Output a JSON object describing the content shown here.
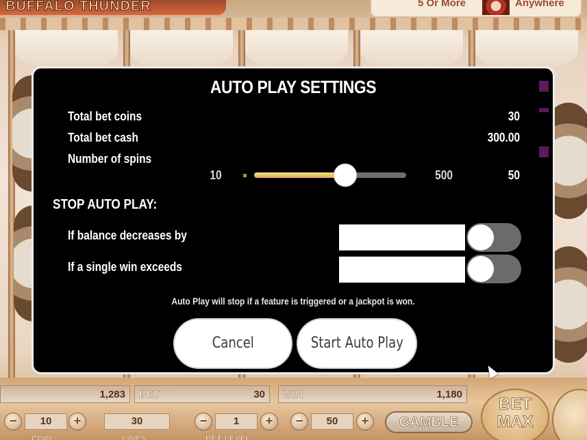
{
  "header": {
    "logo_text": "BUFFALO THUNDER",
    "info_left": "5 Or More",
    "info_right": "Anywhere"
  },
  "modal": {
    "title": "AUTO PLAY SETTINGS",
    "total_bet_coins_label": "Total bet coins",
    "total_bet_coins_value": "30",
    "total_bet_cash_label": "Total bet cash",
    "total_bet_cash_value": "300.00",
    "spins_label": "Number of spins",
    "spins_min": "10",
    "spins_max": "500",
    "spins_value": "50",
    "spins_slider_fraction": 0.6,
    "stop_title": "STOP AUTO PLAY:",
    "balance_label": "If balance decreases by",
    "balance_value": "",
    "win_label": "If a single win exceeds",
    "win_value": "",
    "note": "Auto Play will stop if a feature is triggered or a jackpot is won.",
    "cancel_label": "Cancel",
    "start_label": "Start Auto Play"
  },
  "bottom": {
    "balance_value": "1,283",
    "bet_label": "BET",
    "bet_value": "30",
    "win_label": "WIN",
    "win_value": "1,180",
    "coin_value": "10",
    "lines_value": "30",
    "bet_level_value": "1",
    "coin_val2": "50",
    "gamble_label": "GAMBLE",
    "betmax_label_1": "BET",
    "betmax_label_2": "MAX",
    "coin_caption": "COIN",
    "lines_caption": "LINES",
    "bet_level_caption": "BET LEVEL"
  },
  "colors": {
    "modal_bg": "#000000",
    "slider_fill": "#f1e37a",
    "toggle_off": "#6b6b6b",
    "accent_purple": "#5c1a5a"
  }
}
